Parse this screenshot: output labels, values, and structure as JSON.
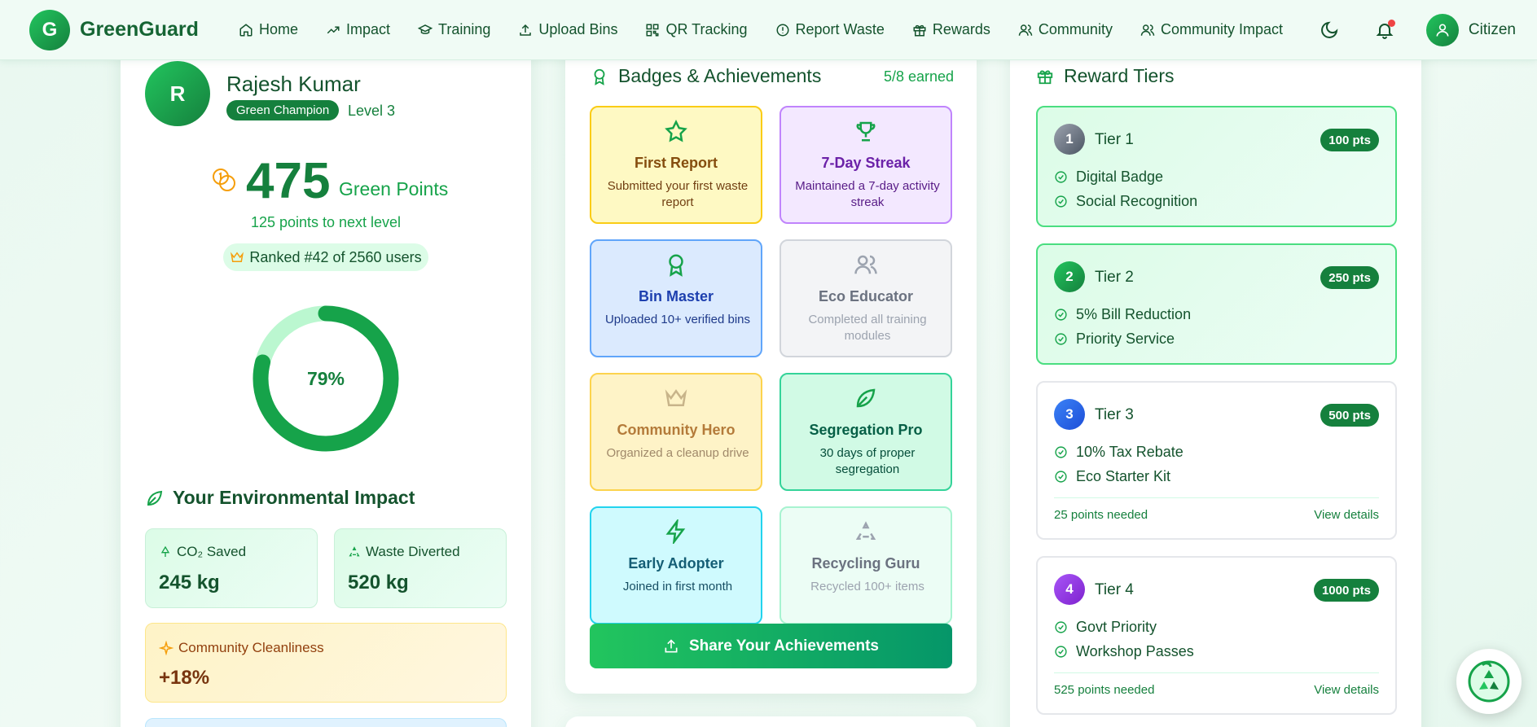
{
  "nav": {
    "brand_letter": "G",
    "brand_name": "GreenGuard",
    "links": [
      {
        "label": "Home",
        "icon": "home-icon"
      },
      {
        "label": "Impact",
        "icon": "trend-icon"
      },
      {
        "label": "Training",
        "icon": "graduation-cap-icon"
      },
      {
        "label": "Upload Bins",
        "icon": "upload-icon"
      },
      {
        "label": "QR Tracking",
        "icon": "qr-icon"
      },
      {
        "label": "Report Waste",
        "icon": "alert-circle-icon"
      },
      {
        "label": "Rewards",
        "icon": "gift-icon"
      },
      {
        "label": "Community",
        "icon": "users-icon"
      },
      {
        "label": "Community Impact",
        "icon": "users-icon"
      }
    ],
    "user_name": "Citizen"
  },
  "profile": {
    "avatar_letter": "R",
    "name": "Rajesh Kumar",
    "rank_badge": "Green Champion",
    "level": "Level 3",
    "points": "475",
    "points_label": "Green Points",
    "next_level": "125 points to next level",
    "ranked": "Ranked #42 of 2560 users",
    "progress_percent": 79,
    "progress_label": "79%"
  },
  "impact": {
    "title": "Your Environmental Impact",
    "co2_label": "CO₂ Saved",
    "co2_value": "245 kg",
    "waste_label": "Waste Diverted",
    "waste_value": "520 kg",
    "clean_label": "Community Cleanliness",
    "clean_value": "+18%"
  },
  "badges": {
    "title": "Badges & Achievements",
    "count": "5/8 earned",
    "items": [
      {
        "title": "First Report",
        "desc": "Submitted your first waste report",
        "icon": "star-icon"
      },
      {
        "title": "7-Day Streak",
        "desc": "Maintained a 7-day activity streak",
        "icon": "trophy-icon"
      },
      {
        "title": "Bin Master",
        "desc": "Uploaded 10+ verified bins",
        "icon": "award-icon"
      },
      {
        "title": "Eco Educator",
        "desc": "Completed all training modules",
        "icon": "users-icon"
      },
      {
        "title": "Community Hero",
        "desc": "Organized a cleanup drive",
        "icon": "crown-icon"
      },
      {
        "title": "Segregation Pro",
        "desc": "30 days of proper segregation",
        "icon": "leaf-icon"
      },
      {
        "title": "Early Adopter",
        "desc": "Joined in first month",
        "icon": "zap-icon"
      },
      {
        "title": "Recycling Guru",
        "desc": "Recycled 100+ items",
        "icon": "recycle-icon"
      }
    ],
    "share_label": "Share Your Achievements"
  },
  "tiers": {
    "title": "Reward Tiers",
    "items": [
      {
        "num": "1",
        "name": "Tier 1",
        "pts": "100 pts",
        "perks": [
          "Digital Badge",
          "Social Recognition"
        ]
      },
      {
        "num": "2",
        "name": "Tier 2",
        "pts": "250 pts",
        "perks": [
          "5% Bill Reduction",
          "Priority Service"
        ]
      },
      {
        "num": "3",
        "name": "Tier 3",
        "pts": "500 pts",
        "perks": [
          "10% Tax Rebate",
          "Eco Starter Kit"
        ],
        "needed": "25 points needed",
        "link": "View details"
      },
      {
        "num": "4",
        "name": "Tier 4",
        "pts": "1000 pts",
        "perks": [
          "Govt Priority",
          "Workshop Passes"
        ],
        "needed": "525 points needed",
        "link": "View details"
      }
    ]
  },
  "colors": {
    "accent": "#15803d",
    "accent_light": "#22c55e"
  }
}
